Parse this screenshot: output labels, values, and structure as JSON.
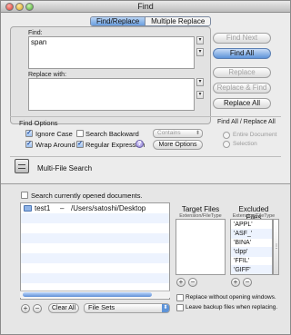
{
  "window": {
    "title": "Find"
  },
  "tabs": [
    {
      "label": "Find/Replace",
      "active": true
    },
    {
      "label": "Multiple Replace",
      "active": false
    }
  ],
  "find": {
    "label": "Find:",
    "value": "span"
  },
  "replace": {
    "label": "Replace with:",
    "value": ""
  },
  "buttons": {
    "find_next": "Find Next",
    "find_all": "Find All",
    "replace": "Replace",
    "replace_find": "Replace & Find",
    "replace_all": "Replace All"
  },
  "options": {
    "title": "Find Options",
    "ignore_case": {
      "label": "Ignore Case",
      "checked": true
    },
    "wrap_around": {
      "label": "Wrap Around",
      "checked": true
    },
    "search_backward": {
      "label": "Search Backward",
      "checked": false
    },
    "regular_expression": {
      "label": "Regular Expression",
      "checked": true
    },
    "match_mode": "Contains",
    "more_options": "More Options",
    "help": "?"
  },
  "scope": {
    "title": "Find All / Replace All",
    "entire_document": "Entire Document",
    "selection": "Selection"
  },
  "multi_file": {
    "label": "Multi-File Search"
  },
  "search_open_docs": {
    "label": "Search currently opened documents.",
    "checked": false
  },
  "folders": [
    {
      "name": "test1",
      "sep": "–",
      "path": "/Users/satoshi/Desktop"
    }
  ],
  "target_files": {
    "title": "Target Files",
    "subtitle": "Extension/FileType"
  },
  "excluded_files": {
    "title": "Excluded Files",
    "subtitle": "Extension/FileType",
    "items": [
      "'APPL'",
      "'ASF_'",
      "'BINA'",
      "'clpp'",
      "'FFIL'",
      "'GIFF'"
    ]
  },
  "list_buttons": {
    "add": "+",
    "remove": "−",
    "clear_all": "Clear All",
    "file_sets": "File Sets"
  },
  "replace_without_opening": {
    "label": "Replace without opening windows.",
    "checked": false
  },
  "leave_backup": {
    "label": "Leave backup files when replacing.",
    "checked": false
  }
}
